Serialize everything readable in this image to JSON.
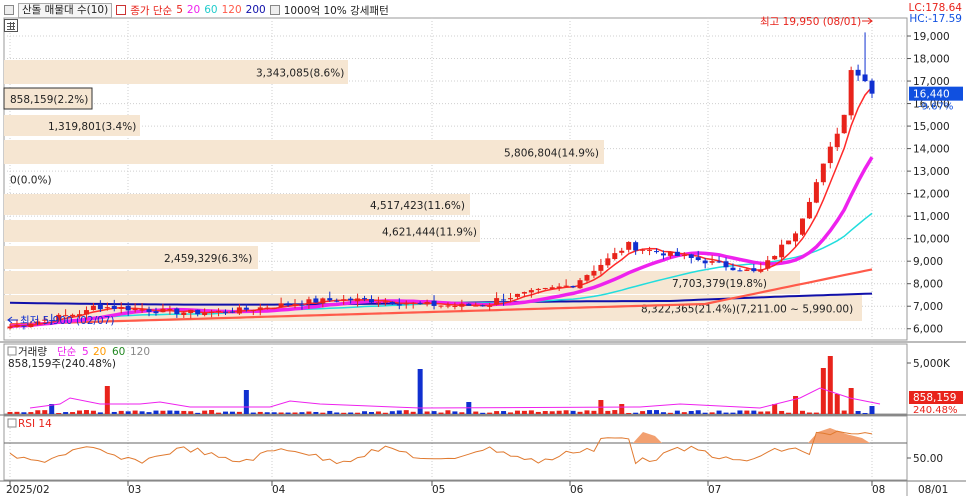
{
  "header": {
    "title": "산돌 매물대 수(10)",
    "ma_label": "종가 단순",
    "ma_periods": [
      "5",
      "20",
      "60",
      "120",
      "200"
    ],
    "ma_colors": [
      "#ff2a2a",
      "#ee22ee",
      "#22dddd",
      "#ff5a4a",
      "#1010aa"
    ],
    "pattern_label": "1000억 10% 강세패턴",
    "lc": "LC:178.64",
    "hc": "HC:-17.59"
  },
  "price_axis": {
    "ticks": [
      "19,000",
      "18,000",
      "17,000",
      "16,000",
      "15,000",
      "14,000",
      "13,000",
      "12,000",
      "11,000",
      "10,000",
      "9,000",
      "8,000",
      "7,000",
      "6,000"
    ],
    "current_price": "16,440",
    "current_change": "-9.67%"
  },
  "annotations": {
    "high": "최고 19,950 (08/01)",
    "low": "최저 5,900 (02/07)"
  },
  "volume_profile": [
    {
      "label": "3,343,085(8.6%)"
    },
    {
      "label": "858,159(2.2%)"
    },
    {
      "label": "1,319,801(3.4%)"
    },
    {
      "label": "5,806,804(14.9%)"
    },
    {
      "label": "0(0.0%)"
    },
    {
      "label": "4,517,423(11.6%)"
    },
    {
      "label": "4,621,444(11.9%)"
    },
    {
      "label": "2,459,329(6.3%)"
    },
    {
      "label": "7,703,379(19.8%)"
    },
    {
      "label": "8,322,365(21.4%)(7,211.00 ~ 5,990.00)"
    }
  ],
  "volume_panel": {
    "title": "거래량",
    "ma_label": "단순",
    "ma_periods": [
      "5",
      "20",
      "60",
      "120"
    ],
    "ma_colors": [
      "#ee22ee",
      "#ff9900",
      "#228822",
      "#888888"
    ],
    "current": "858,159주(240.48%)",
    "axis_tick": "5,000K",
    "current_value": "858,159",
    "current_pct": "240.48%"
  },
  "rsi_panel": {
    "title": "RSI 14",
    "axis_tick": "50.00"
  },
  "date_axis": {
    "labels": [
      "2025/02",
      "03",
      "04",
      "05",
      "06",
      "07",
      "08",
      "08/01"
    ]
  },
  "colors": {
    "up": "#e8231b",
    "down": "#1030d0",
    "profile_fill": "#f6e6d2",
    "label_blue": "#1050e0"
  },
  "chart_data": {
    "type": "candlestick",
    "price_range": [
      5500,
      19800
    ],
    "high": 19950,
    "low": 5900,
    "current": 16440
  }
}
